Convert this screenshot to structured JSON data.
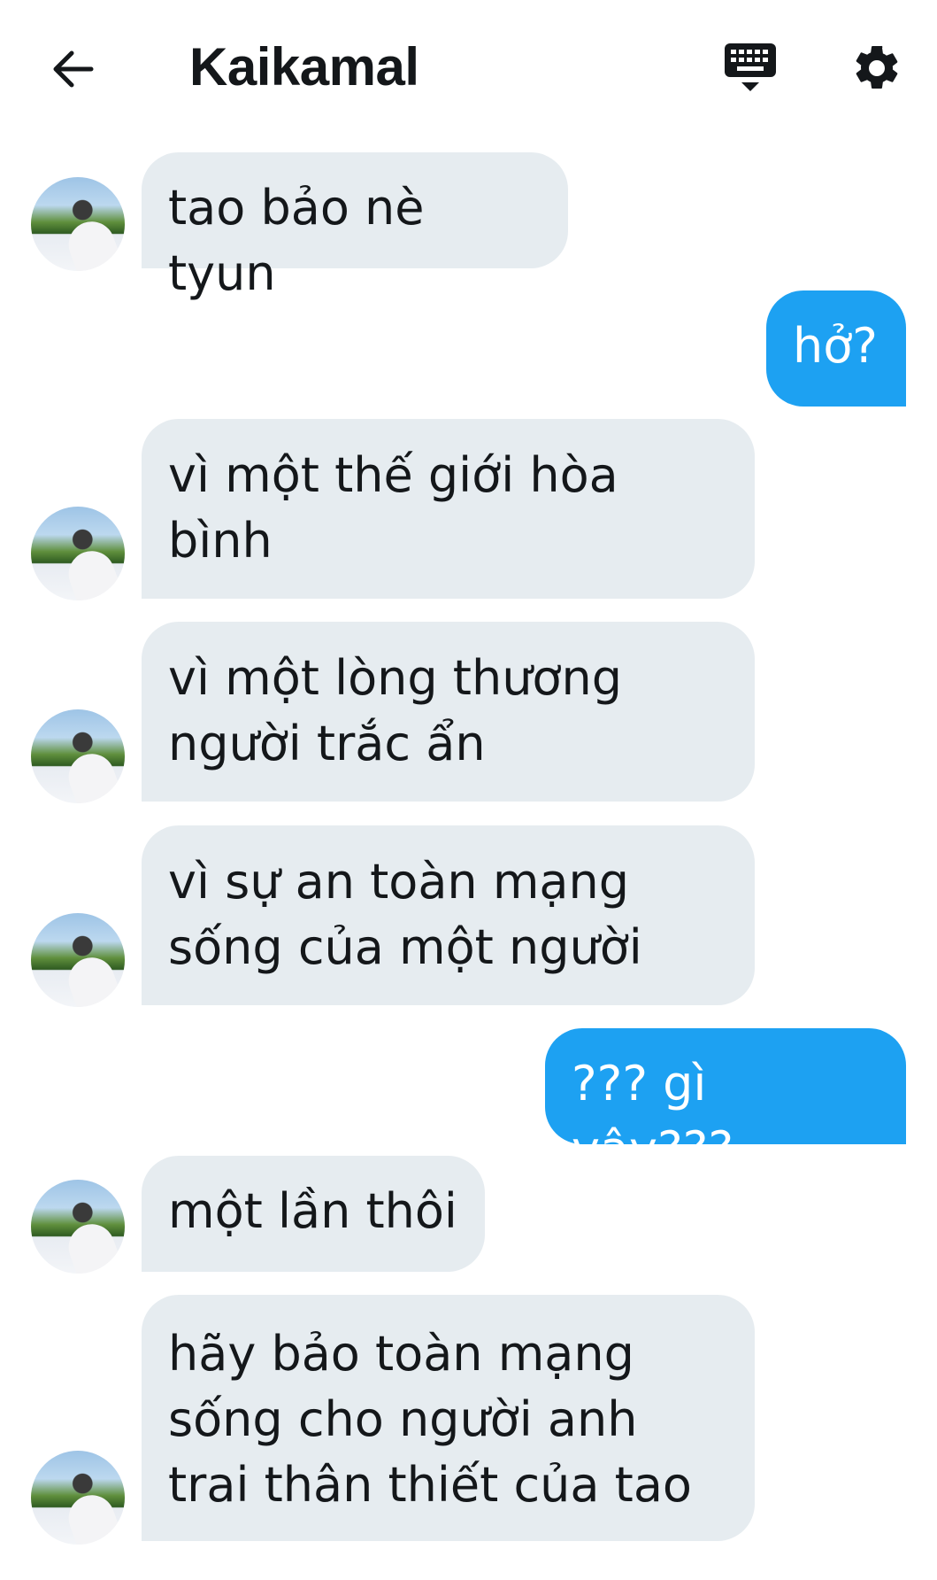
{
  "header": {
    "title": "Kaikamal",
    "back_icon": "arrow-left-icon",
    "keyboard_icon": "keyboard-icon",
    "settings_icon": "gear-icon"
  },
  "colors": {
    "incoming_bubble": "#e6ecf0",
    "outgoing_bubble": "#1da1f2",
    "text": "#14171a"
  },
  "messages": [
    {
      "direction": "in",
      "text": "tao bảo nè tyun"
    },
    {
      "direction": "out",
      "text": "hở?"
    },
    {
      "direction": "in",
      "text": "vì một thế giới hòa bình"
    },
    {
      "direction": "in",
      "text": "vì một lòng thương người trắc ẩn"
    },
    {
      "direction": "in",
      "text": "vì sự an toàn mạng sống của một người"
    },
    {
      "direction": "out",
      "text": "??? gì vậy???"
    },
    {
      "direction": "in",
      "text": "một lần thôi"
    },
    {
      "direction": "in",
      "text": "hãy bảo toàn mạng sống cho người anh trai thân thiết của tao"
    }
  ]
}
